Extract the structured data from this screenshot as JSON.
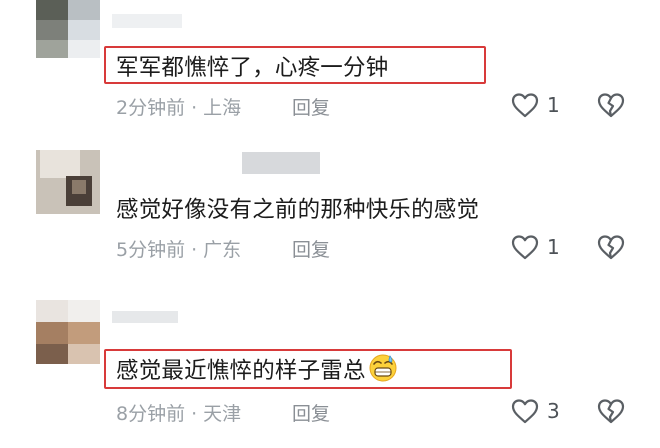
{
  "comments": [
    {
      "text": "军军都憔悴了，心疼一分钟",
      "time": "2分钟前",
      "location": "上海",
      "reply_label": "回复",
      "likes": "1",
      "highlighted": true
    },
    {
      "text": "感觉好像没有之前的那种快乐的感觉",
      "time": "5分钟前",
      "location": "广东",
      "reply_label": "回复",
      "likes": "1",
      "highlighted": false
    },
    {
      "text": "感觉最近憔悴的样子雷总",
      "emoji": "grinning-sweat-emoji",
      "time": "8分钟前",
      "location": "天津",
      "reply_label": "回复",
      "likes": "3",
      "highlighted": true
    }
  ],
  "colors": {
    "highlight_border": "#d83a3a",
    "meta_text": "#9aa0a6",
    "icon_stroke": "#5a5f64"
  },
  "icons": {
    "like": "heart-outline-icon",
    "dislike": "broken-heart-icon",
    "separator": "·"
  }
}
